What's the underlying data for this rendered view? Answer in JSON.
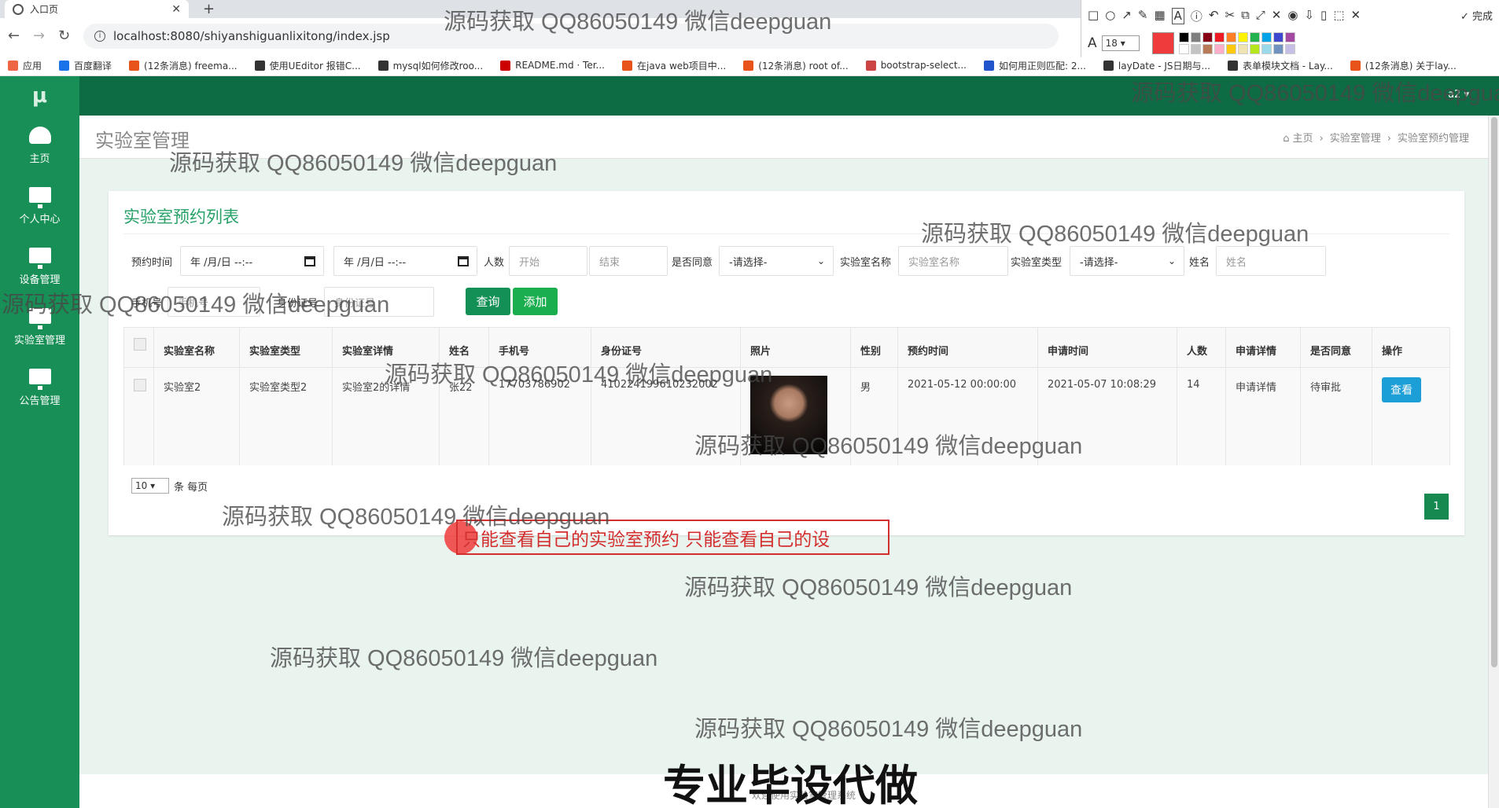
{
  "browser": {
    "tab_title": "入口页",
    "url": "localhost:8080/shiyanshiguanlixitong/index.jsp",
    "bookmarks": [
      "应用",
      "百度翻译",
      "(12条消息) freema...",
      "使用UEditor 报错C...",
      "mysql如何修改roo...",
      "README.md · Ter...",
      "在java web项目中...",
      "(12条消息) root of...",
      "bootstrap-select...",
      "如何用正则匹配: 2...",
      "layDate - JS日期与...",
      "表单模块文档 - Lay...",
      "(12条消息) 关于lay..."
    ]
  },
  "annotation_toolbar": {
    "font_size": "18",
    "done_label": "完成",
    "palette": [
      "#000000",
      "#7f7f7f",
      "#880015",
      "#ed1c24",
      "#ff7f27",
      "#fff200",
      "#22b14c",
      "#00a2e8",
      "#3f48cc",
      "#a349a4",
      "#ffffff",
      "#c3c3c3",
      "#b97a57",
      "#ffaec9",
      "#ffc90e",
      "#efe4b0",
      "#b5e61d",
      "#99d9ea",
      "#7092be",
      "#c8bfe7"
    ]
  },
  "app": {
    "user_menu": "a2 ▾",
    "sidebar": [
      {
        "label": "主页",
        "icon": "dashboard-icon"
      },
      {
        "label": "个人中心",
        "icon": "monitor-icon"
      },
      {
        "label": "设备管理",
        "icon": "monitor-icon"
      },
      {
        "label": "实验室管理",
        "icon": "monitor-icon"
      },
      {
        "label": "公告管理",
        "icon": "monitor-icon"
      }
    ],
    "page_title": "实验室管理",
    "breadcrumb": [
      "主页",
      "实验室管理",
      "实验室预约管理"
    ],
    "card_title": "实验室预约列表",
    "filters": {
      "appt_time_label": "预约时间",
      "date_placeholder": "年 /月/日 --:--",
      "count_label": "人数",
      "count_start": "开始",
      "count_end": "结束",
      "agree_label": "是否同意",
      "select_default": "-请选择-",
      "labname_label": "实验室名称",
      "labname_placeholder": "实验室名称",
      "labtype_label": "实验室类型",
      "name_label": "姓名",
      "name_placeholder": "姓名",
      "phone_label": "手机号",
      "phone_placeholder": "手机号",
      "idcard_label": "身份证号",
      "idcard_placeholder": "身份证号",
      "query_btn": "查询",
      "add_btn": "添加"
    },
    "table": {
      "headers": [
        "实验室名称",
        "实验室类型",
        "实验室详情",
        "姓名",
        "手机号",
        "身份证号",
        "照片",
        "性别",
        "预约时间",
        "申请时间",
        "人数",
        "申请详情",
        "是否同意",
        "操作"
      ],
      "rows": [
        {
          "lab_name": "实验室2",
          "lab_type": "实验室类型2",
          "lab_detail": "实验室2的详情",
          "name": "张22",
          "phone": "17703786902",
          "idcard": "410224199610232002",
          "gender": "男",
          "appt_time": "2021-05-12 00:00:00",
          "apply_time": "2021-05-07 10:08:29",
          "count": "14",
          "apply_detail": "申请详情",
          "agree": "待审批",
          "action": "查看"
        }
      ]
    },
    "page_size": "10",
    "page_size_suffix": "条 每页",
    "current_page": "1",
    "footer": "欢迎使用实验室管理系统"
  },
  "annotation_text": "只能查看自己的实验室预约 只能查看自己的设",
  "watermark": "源码获取 QQ86050149 微信deepguan",
  "banner": "专业毕设代做"
}
